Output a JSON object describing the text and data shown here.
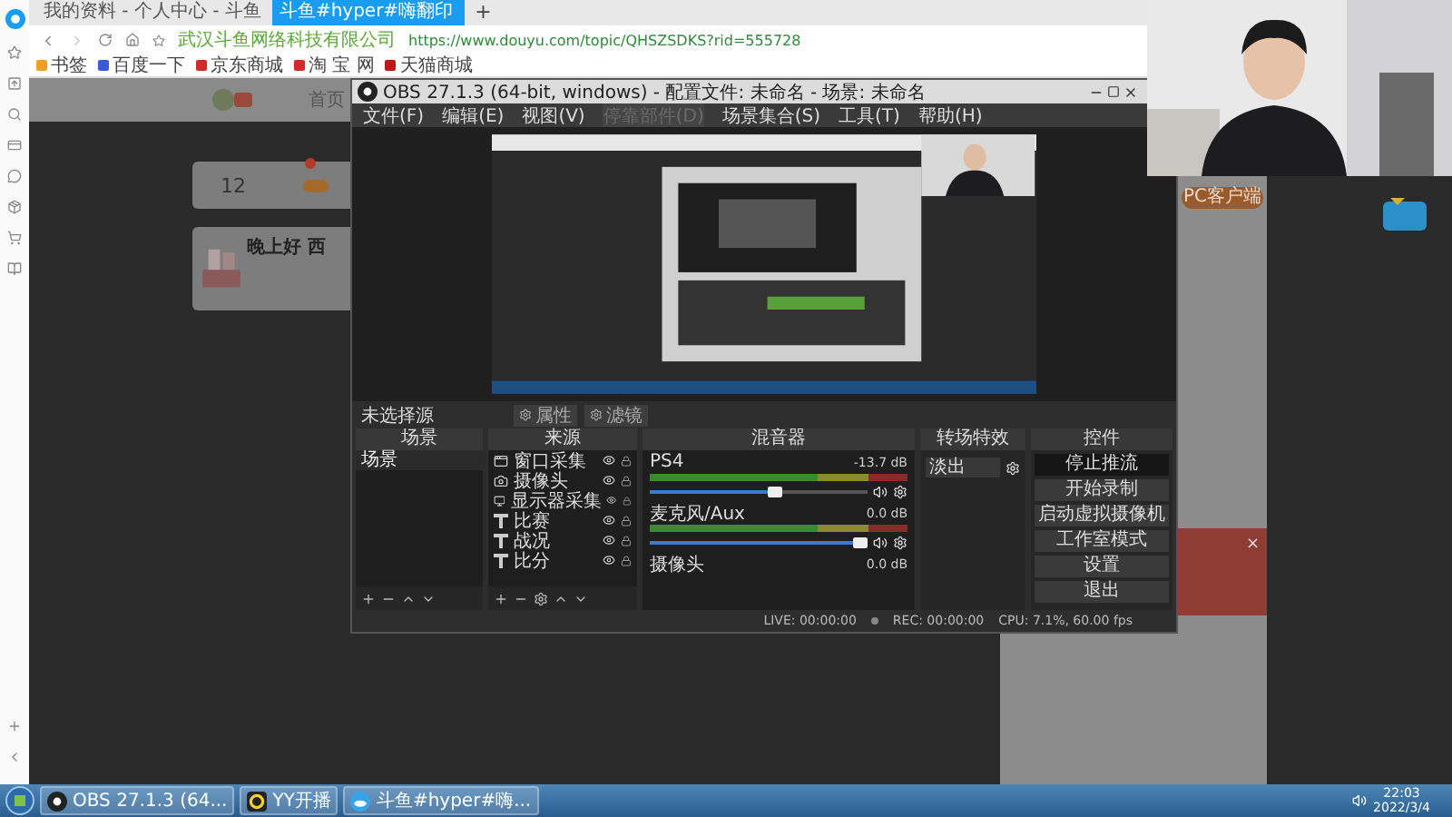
{
  "browser": {
    "tabs": [
      {
        "title": "我的资料 - 个人中心 - 斗鱼",
        "selected": false
      },
      {
        "title": "斗鱼#hyper#嗨翻印",
        "selected": true
      }
    ],
    "new_tab": "+",
    "site_name": "武汉斗鱼网络科技有限公司",
    "url": "https://www.douyu.com/topic/QHSZSDKS?rid=555728",
    "bookmarks": [
      "书签",
      "百度一下",
      "京东商城",
      "淘 宝 网",
      "天猫商城"
    ]
  },
  "page": {
    "nav": "首页",
    "stat_value": "12",
    "greeting": "晚上好 西",
    "client_button": "PC客户端",
    "banner_close": "×"
  },
  "obs": {
    "title": "OBS 27.1.3 (64-bit, windows) - 配置文件: 未命名 - 场景: 未命名",
    "menu": [
      {
        "label": "文件(F)",
        "disabled": false
      },
      {
        "label": "编辑(E)",
        "disabled": false
      },
      {
        "label": "视图(V)",
        "disabled": false
      },
      {
        "label": "停靠部件(D)",
        "disabled": true
      },
      {
        "label": "场景集合(S)",
        "disabled": false
      },
      {
        "label": "工具(T)",
        "disabled": false
      },
      {
        "label": "帮助(H)",
        "disabled": false
      }
    ],
    "source_status": "未选择源",
    "source_buttons": [
      "属性",
      "滤镜"
    ],
    "scenes": {
      "title": "场景",
      "items": [
        {
          "label": "场景",
          "selected": true
        }
      ]
    },
    "sources": {
      "title": "来源",
      "items": [
        {
          "label": "窗口采集",
          "kind": "window"
        },
        {
          "label": "摄像头",
          "kind": "camera"
        },
        {
          "label": "显示器采集",
          "kind": "display"
        },
        {
          "label": "比赛",
          "kind": "text"
        },
        {
          "label": "战况",
          "kind": "text"
        },
        {
          "label": "比分",
          "kind": "text"
        }
      ]
    },
    "mixer": {
      "title": "混音器",
      "tracks": [
        {
          "name": "PS4",
          "reading": "-13.7 dB",
          "level": 0.58
        },
        {
          "name": "麦克风/Aux",
          "reading": "0.0 dB",
          "level": 1
        },
        {
          "name": "摄像头",
          "reading": "0.0 dB"
        }
      ]
    },
    "transitions": {
      "title": "转场特效",
      "value": "淡出"
    },
    "controls": {
      "title": "控件",
      "buttons": [
        {
          "label": "停止推流",
          "active": true
        },
        {
          "label": "开始录制",
          "active": false
        },
        {
          "label": "启动虚拟摄像机",
          "active": false
        },
        {
          "label": "工作室模式",
          "active": false
        },
        {
          "label": "设置",
          "active": false
        },
        {
          "label": "退出",
          "active": false
        }
      ]
    },
    "status": {
      "live": "LIVE: 00:00:00",
      "rec": "REC: 00:00:00",
      "cpu": "CPU: 7.1%, 60.00 fps"
    }
  },
  "taskbar": {
    "items": [
      {
        "label": "OBS 27.1.3 (64...",
        "kind": "obs"
      },
      {
        "label": "YY开播",
        "kind": "yy"
      },
      {
        "label": "斗鱼#hyper#嗨...",
        "kind": "browser"
      }
    ],
    "time": "22:03",
    "date": "2022/3/4"
  }
}
